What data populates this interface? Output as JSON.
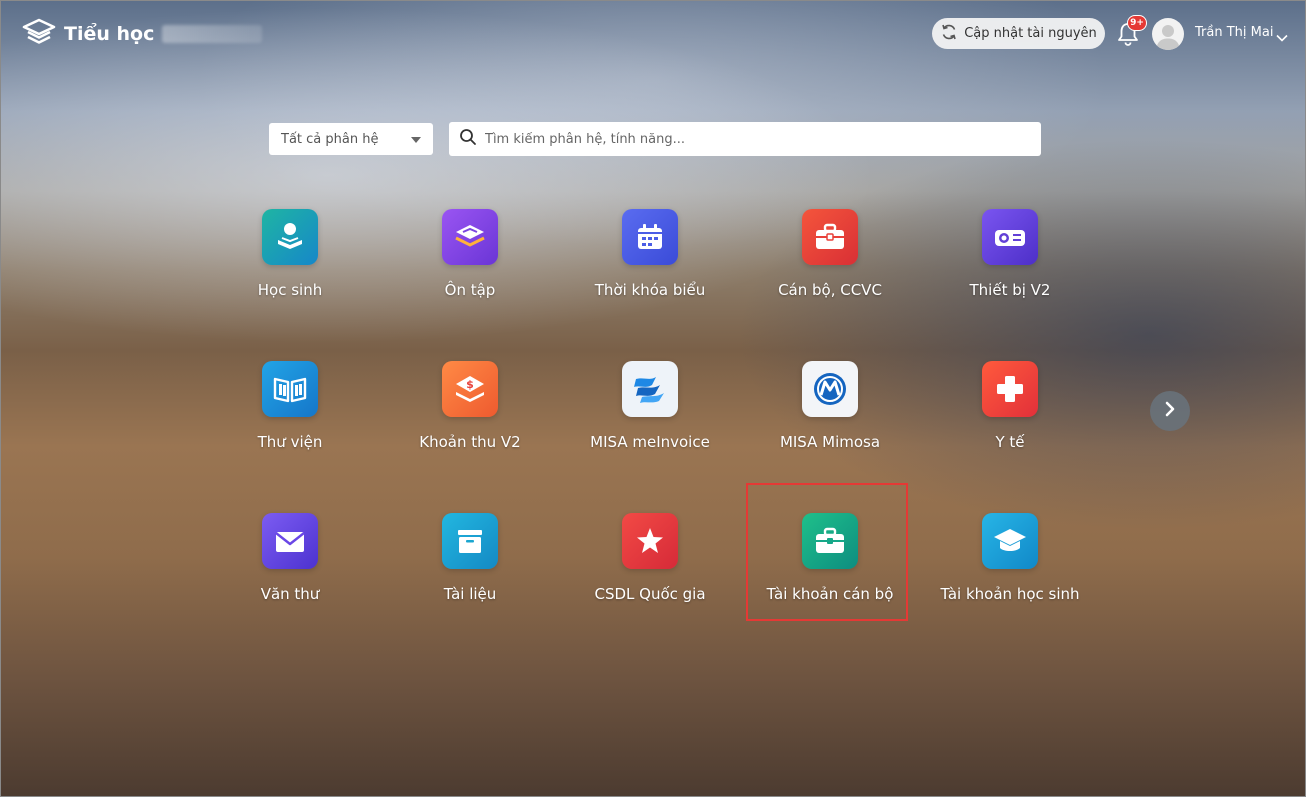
{
  "header": {
    "brand": "Tiểu học",
    "update_label": "Cập nhật tài nguyên",
    "notification_badge": "9+",
    "user_name": "Trần Thị Mai"
  },
  "filters": {
    "module_select": "Tất cả phân hệ",
    "search_placeholder": "Tìm kiếm phân hệ, tính năng..."
  },
  "apps": [
    {
      "label": "Học sinh",
      "icon": "student-icon",
      "color": "#17a2a8"
    },
    {
      "label": "Ôn tập",
      "icon": "review-icon",
      "color": "#7b45e0"
    },
    {
      "label": "Thời khóa biểu",
      "icon": "calendar-icon",
      "color": "#4b5de6"
    },
    {
      "label": "Cán bộ, CCVC",
      "icon": "briefcase-icon",
      "color": "#e8413a"
    },
    {
      "label": "Thiết bị V2",
      "icon": "projector-icon",
      "color": "#6240d6"
    },
    {
      "label": "Thư viện",
      "icon": "library-icon",
      "color": "#1c8fd6"
    },
    {
      "label": "Khoản thu V2",
      "icon": "fee-icon",
      "color": "#f06a3a"
    },
    {
      "label": "MISA meInvoice",
      "icon": "meinvoice-logo",
      "color": "#eef3f9"
    },
    {
      "label": "MISA Mimosa",
      "icon": "mimosa-logo",
      "color": "#f3f5f8"
    },
    {
      "label": "Y tế",
      "icon": "medical-icon",
      "color": "#ee4032"
    },
    {
      "label": "Văn thư",
      "icon": "mail-icon",
      "color": "#6a47e6"
    },
    {
      "label": "Tài liệu",
      "icon": "archive-box-icon",
      "color": "#1aa6d0"
    },
    {
      "label": "CSDL Quốc gia",
      "icon": "star-icon",
      "color": "#e8373d"
    },
    {
      "label": "Tài khoản cán bộ",
      "icon": "staff-account-icon",
      "color": "#16a889"
    },
    {
      "label": "Tài khoản học sinh",
      "icon": "graduation-cap-icon",
      "color": "#1ba3d6"
    }
  ],
  "highlight_color": "#e53935"
}
